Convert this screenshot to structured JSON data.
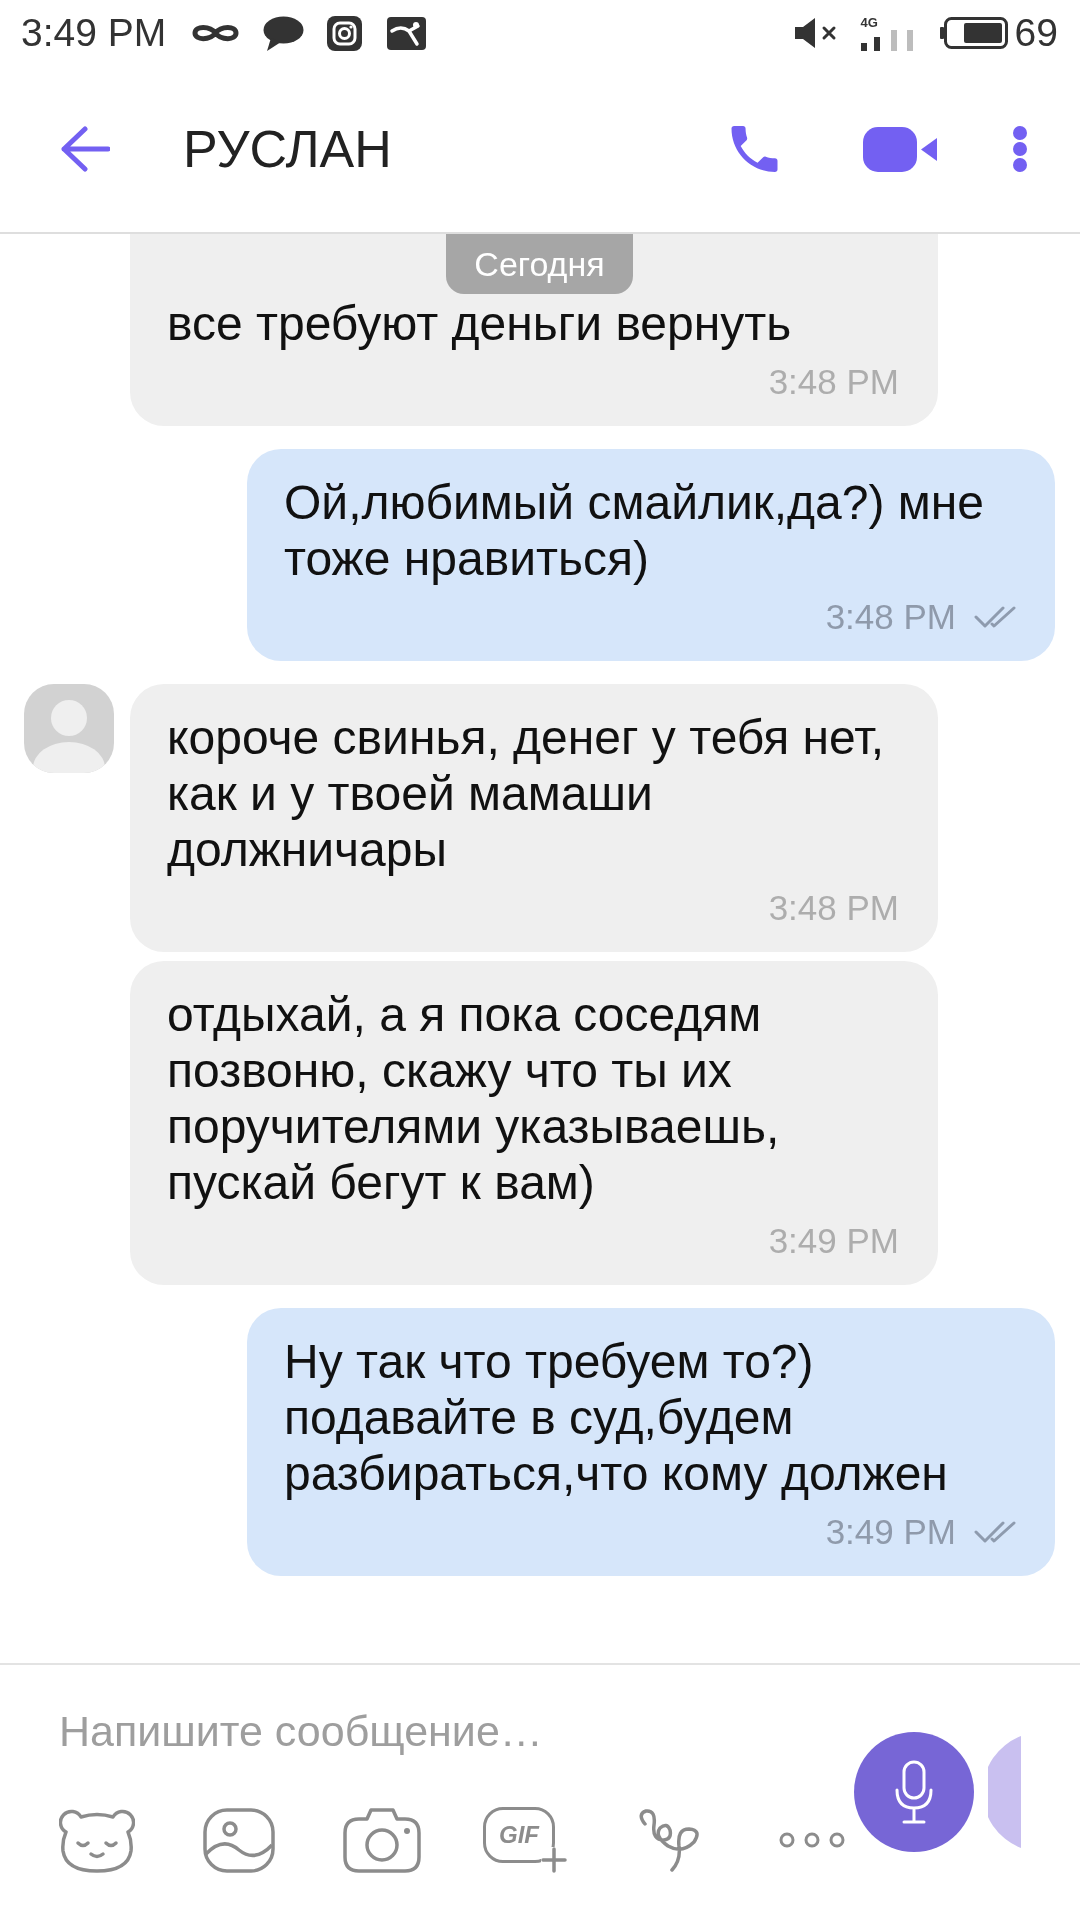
{
  "status_bar": {
    "time": "3:49 PM",
    "network": "4G",
    "battery": "69"
  },
  "header": {
    "title": "РУСЛАН"
  },
  "date_chip": {
    "label": "Сегодня"
  },
  "messages": [
    {
      "kind": "incoming",
      "text": "все требуют деньги вернуть",
      "time": "3:48 PM",
      "avatar": false,
      "cut_top": true
    },
    {
      "kind": "outgoing",
      "text": "Ой,любимый смайлик,да?) мне тоже нравиться)",
      "time": "3:48 PM",
      "seen": false,
      "cut_top": false
    },
    {
      "kind": "incoming",
      "text": "короче свинья, денег у тебя нет, как и у твоей мамаши должничары",
      "time": "3:48 PM",
      "avatar": true,
      "cut_top": false
    },
    {
      "kind": "incoming",
      "text": "отдыхай, а я пока соседям позвоню, скажу что ты их поручителями указываешь, пускай бегут к вам)",
      "time": "3:49 PM",
      "avatar": false,
      "cut_top": false
    },
    {
      "kind": "outgoing",
      "text": "Ну так что требуем то?) подавайте в суд,будем разбираться,что кому должен",
      "time": "3:49 PM",
      "seen": false,
      "cut_top": false
    }
  ],
  "composer": {
    "placeholder": "Напишите сообщение…",
    "gif_label": "GIF"
  }
}
